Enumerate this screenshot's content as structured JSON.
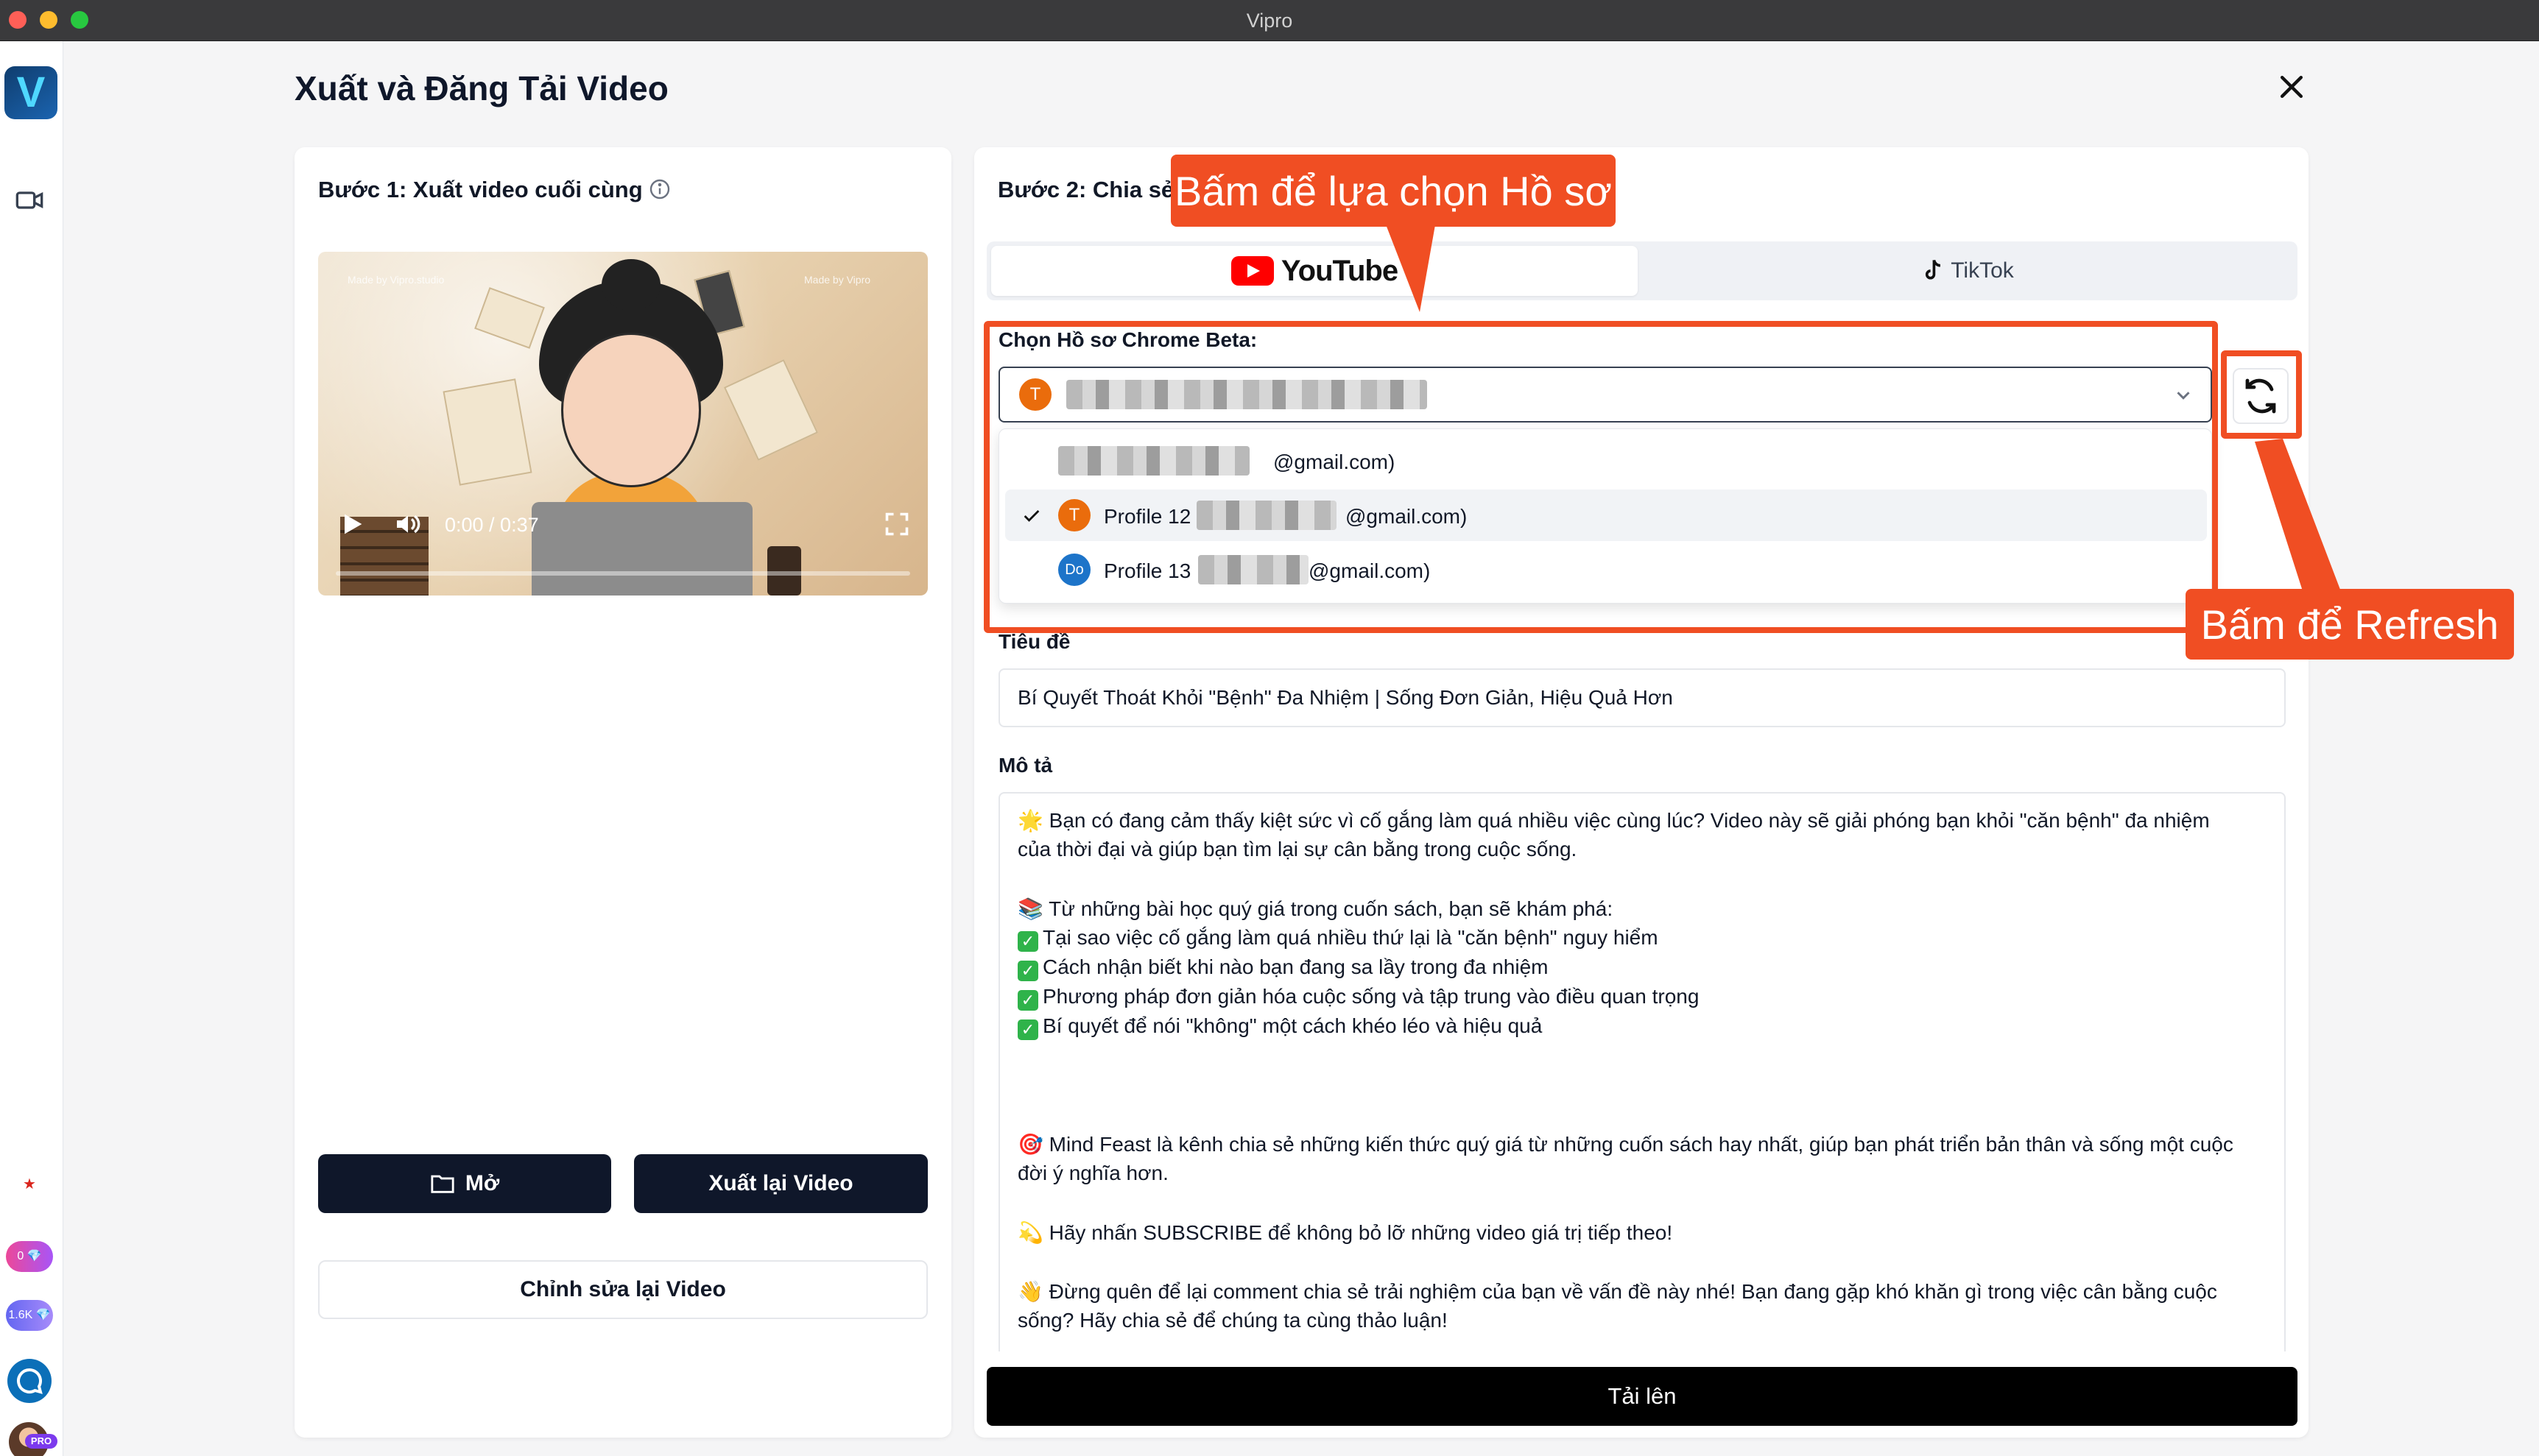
{
  "window": {
    "title": "Vipro"
  },
  "rail": {
    "pill_1": "0 💎",
    "pill_2": "1.6K 💎",
    "pro_badge": "PRO",
    "flag": "★"
  },
  "page": {
    "title": "Xuất và Đăng Tải Video"
  },
  "step1": {
    "title": "Bước 1: Xuất video cuối cùng",
    "watermark_left": "Made by Vipro.studio",
    "watermark_right": "Made by Vipro",
    "time": "0:00 / 0:37",
    "open_label": "Mở",
    "export_label": "Xuất lại Video",
    "edit_label": "Chỉnh sửa lại Video"
  },
  "step2": {
    "title": "Bước 2: Chia sẻ",
    "tabs": {
      "youtube": "YouTube",
      "tiktok": "TikTok"
    },
    "profile_label": "Chọn Hồ sơ Chrome Beta:",
    "selected_avatar": "T",
    "dropdown": [
      {
        "avatar": "",
        "name": "",
        "suffix": "@gmail.com)"
      },
      {
        "avatar": "T",
        "name": "Profile 12",
        "suffix": "@gmail.com)"
      },
      {
        "avatar": "Do",
        "name": "Profile 13",
        "suffix": "@gmail.com)"
      }
    ],
    "title_label": "Tiêu đề",
    "title_value": "Bí Quyết Thoát Khỏi \"Bệnh\" Đa Nhiệm | Sống Đơn Giản, Hiệu Quả Hơn",
    "description_label": "Mô tả",
    "description_lines": [
      "🌟 Bạn có đang cảm thấy kiệt sức vì cố gắng làm quá nhiều việc cùng lúc? Video này sẽ giải phóng bạn khỏi \"căn bệnh\" đa nhiệm",
      "của thời đại và giúp bạn tìm lại sự cân bằng trong cuộc sống.",
      "📚 Từ những bài học quý giá trong cuốn sách, bạn sẽ khám phá:",
      "Tại sao việc cố gắng làm quá nhiều thứ lại là \"căn bệnh\" nguy hiểm",
      "Cách nhận biết khi nào bạn đang sa lầy trong đa nhiệm",
      "Phương pháp đơn giản hóa cuộc sống và tập trung vào điều quan trọng",
      "Bí quyết để nói \"không\" một cách khéo léo và hiệu quả",
      "🎯 Mind Feast là kênh chia sẻ những kiến thức quý giá từ những cuốn sách hay nhất, giúp bạn phát triển bản thân và sống một cuộc",
      "đời ý nghĩa hơn.",
      "💫 Hãy nhấn SUBSCRIBE để không bỏ lỡ những video giá trị tiếp theo!",
      "👋 Đừng quên để lại comment chia sẻ trải nghiệm của bạn về vấn đề này nhé! Bạn đang gặp khó khăn gì trong việc cân bằng cuộc",
      "sống? Hãy chia sẻ để chúng ta cùng thảo luận!"
    ],
    "upload_label": "Tải lên"
  },
  "annotations": {
    "callout_profile": "Bấm để lựa chọn Hồ sơ",
    "callout_refresh": "Bấm để Refresh",
    "color": "#f04e23"
  }
}
